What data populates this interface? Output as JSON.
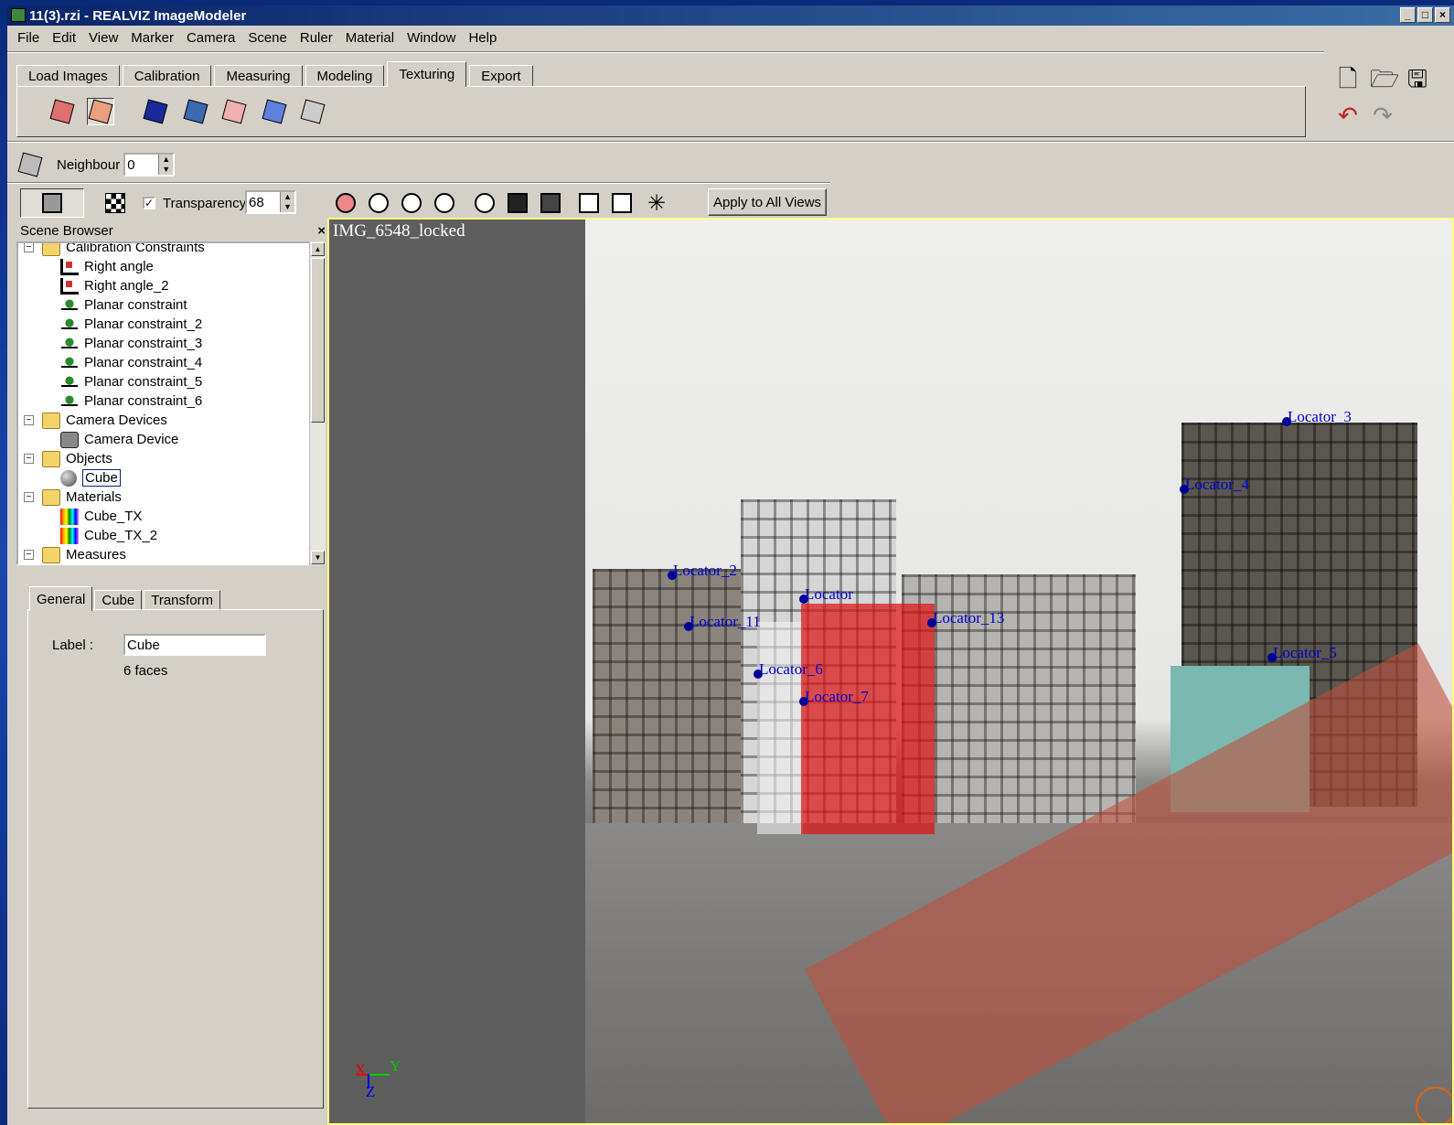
{
  "window": {
    "title": "11(3).rzi - REALVIZ ImageModeler"
  },
  "menu": [
    "File",
    "Edit",
    "View",
    "Marker",
    "Camera",
    "Scene",
    "Ruler",
    "Material",
    "Window",
    "Help"
  ],
  "workflow_tabs": [
    "Load Images",
    "Calibration",
    "Measuring",
    "Modeling",
    "Texturing",
    "Export"
  ],
  "active_tab": "Texturing",
  "neighbour": {
    "label": "Neighbour",
    "value": "0"
  },
  "transparency": {
    "label": "Transparency",
    "value": "68",
    "checked": true
  },
  "apply_button": "Apply to All Views",
  "scene_browser": {
    "title": "Scene Browser",
    "close": "×",
    "items": [
      {
        "label": "Calibration Constraints",
        "type": "folder",
        "level": 0
      },
      {
        "label": "Right angle",
        "type": "right-angle",
        "level": 1
      },
      {
        "label": "Right angle_2",
        "type": "right-angle",
        "level": 1
      },
      {
        "label": "Planar constraint",
        "type": "planar",
        "level": 1
      },
      {
        "label": "Planar constraint_2",
        "type": "planar",
        "level": 1
      },
      {
        "label": "Planar constraint_3",
        "type": "planar",
        "level": 1
      },
      {
        "label": "Planar constraint_4",
        "type": "planar",
        "level": 1
      },
      {
        "label": "Planar constraint_5",
        "type": "planar",
        "level": 1
      },
      {
        "label": "Planar constraint_6",
        "type": "planar",
        "level": 1
      },
      {
        "label": "Camera Devices",
        "type": "folder",
        "level": 0
      },
      {
        "label": "Camera Device",
        "type": "camera",
        "level": 1
      },
      {
        "label": "Objects",
        "type": "folder",
        "level": 0
      },
      {
        "label": "Cube",
        "type": "object",
        "level": 1
      },
      {
        "label": "Materials",
        "type": "folder",
        "level": 0
      },
      {
        "label": "Cube_TX",
        "type": "material",
        "level": 1
      },
      {
        "label": "Cube_TX_2",
        "type": "material",
        "level": 1
      },
      {
        "label": "Measures",
        "type": "folder",
        "level": 0
      }
    ]
  },
  "properties": {
    "tabs": [
      "General",
      "Cube",
      "Transform"
    ],
    "label_caption": "Label :",
    "label_value": "Cube",
    "faces": "6 faces"
  },
  "viewport": {
    "title": "IMG_6548_locked",
    "locators": [
      "Locator_2",
      "Locator",
      "Locator_11",
      "Locator_13",
      "Locator_6",
      "Locator_7",
      "Locator_3",
      "Locator_4",
      "Locator_5"
    ],
    "axes": {
      "x": "X",
      "y": "Y",
      "z": "Z"
    }
  },
  "colors": {
    "title_bar": "#0a246a",
    "chrome": "#d4d0c8",
    "selection": "#dc1414",
    "locator": "#0000cc",
    "viewport_border": "#ffff80"
  }
}
